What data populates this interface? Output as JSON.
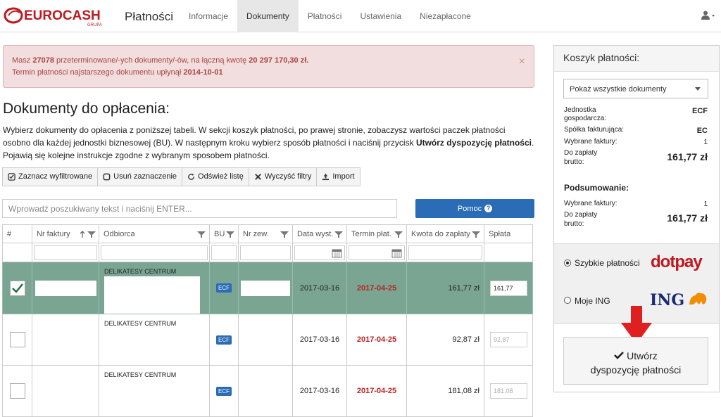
{
  "nav": {
    "brand_logo_text": "EUROCASH",
    "brand_logo_sub": "GRUPA",
    "title": "Płatności",
    "tabs": [
      {
        "label": "Informacje",
        "active": false
      },
      {
        "label": "Dokumenty",
        "active": true
      },
      {
        "label": "Płatności",
        "active": false
      },
      {
        "label": "Ustawienia",
        "active": false
      },
      {
        "label": "Niezapłacone",
        "active": false
      }
    ],
    "user_icon": "user-icon"
  },
  "alert": {
    "p1": "Masz ",
    "count": "27078",
    "p2": " przeterminowane/-ych dokumenty/-ów, na łączną kwotę ",
    "amount": "20 297 170,30 zł.",
    "p3": "Termin płatności najstarszego dokumentu upłynął ",
    "date": "2014-10-01",
    "close": "×"
  },
  "main": {
    "heading": "Dokumenty do opłacenia:",
    "intro_1": "Wybierz dokumenty do opłacenia z poniższej tabeli. W sekcji koszyk płatności, po prawej stronie, zobaczysz wartości paczek płatności osobno dla każdej jednostki biznesowej (BU). W następnym kroku wybierz sposób płatności i naciśnij przycisk ",
    "intro_bold": "Utwórz dyspozycję płatności",
    "intro_2": ". Pojawią się kolejne instrukcje zgodne z wybranym sposobem płatności."
  },
  "toolbar": {
    "mark_filtered": "Zaznacz wyfiltrowane",
    "clear_selection": "Usuń zaznaczenie",
    "refresh": "Odśwież listę",
    "clear_filters": "Wyczyść filtry",
    "import": "Import"
  },
  "search": {
    "placeholder": "Wprowadź poszukiwany tekst i naciśnij ENTER...",
    "help_label": "Pomoc"
  },
  "table": {
    "headers": [
      "#",
      "Nr faktury",
      "Odbiorca",
      "BU",
      "Nr zew.",
      "Data wyst.",
      "Termin płat.",
      "Kwota do zapłaty",
      "Spłata"
    ],
    "rows": [
      {
        "selected": true,
        "recipient": "DELIKATESY CENTRUM",
        "bu": "ECF",
        "issue_date": "2017-03-16",
        "due_date": "2017-04-25",
        "amount": "161,77 zł",
        "payment": "161,77"
      },
      {
        "selected": false,
        "recipient": "DELIKATESY CENTRUM",
        "bu": "ECF",
        "issue_date": "2017-03-16",
        "due_date": "2017-04-25",
        "amount": "92,87 zł",
        "payment": "92,87"
      },
      {
        "selected": false,
        "recipient": "DELIKATESY CENTRUM",
        "bu": "ECF",
        "issue_date": "2017-03-16",
        "due_date": "2017-04-25",
        "amount": "181,08 zł",
        "payment": "181,08"
      }
    ]
  },
  "cart": {
    "title": "Koszyk płatności:",
    "filter_value": "Pokaż wszystkie dokumenty",
    "unit_label": "Jednostka gospodarcza:",
    "unit_value": "ECF",
    "company_label": "Spółka fakturująca:",
    "company_value": "EC",
    "selected_label": "Wybrane faktury:",
    "selected_value": "1",
    "due_label": "Do zapłaty brutto:",
    "due_value": "161,77 zł",
    "summary_title": "Podsumowanie:",
    "sum_selected_label": "Wybrane faktury:",
    "sum_selected_value": "1",
    "sum_due_label": "Do zapłaty brutto:",
    "sum_due_value": "161,77 zł",
    "pay_fast": "Szybkie płatności",
    "pay_fast_logo": "dotpay",
    "pay_ing": "Moje ING",
    "pay_ing_logo": "ING",
    "create_line1": "Utwórz",
    "create_line2": "dyspozycję płatności"
  },
  "colors": {
    "alert_bg": "#f2dede",
    "alert_text": "#a94442",
    "selected_row": "#7aa593",
    "primary": "#2a6cb6",
    "due_red": "#b22222",
    "brand_red": "#c0181f",
    "arrow_red": "#e02020"
  }
}
